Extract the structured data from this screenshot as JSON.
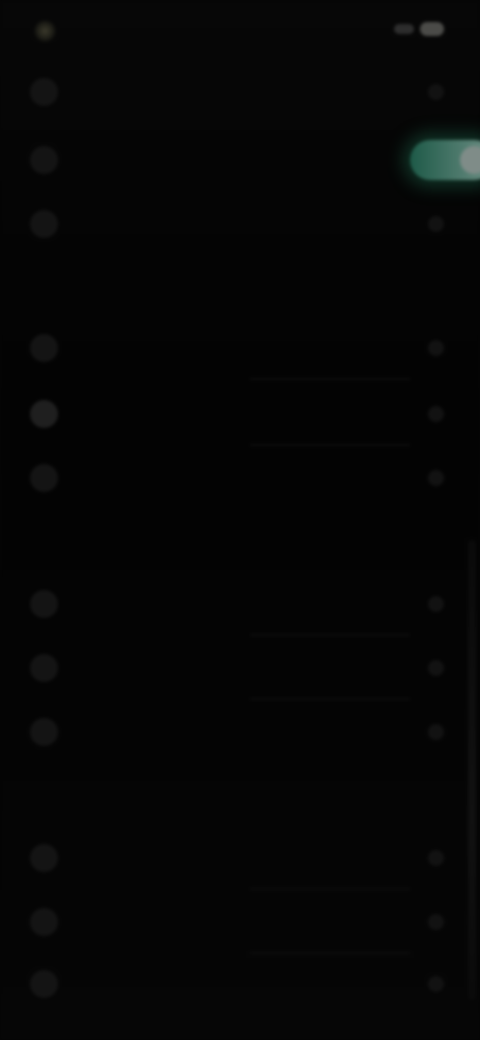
{
  "status_bar": {
    "left_text": "",
    "right_text": ""
  },
  "rows": [
    {
      "id": "row-1",
      "label": ""
    },
    {
      "id": "row-2",
      "label": ""
    },
    {
      "id": "row-3",
      "label": ""
    }
  ],
  "sections": [
    {
      "id": "section-1",
      "title": "",
      "rows": [
        {
          "label": ""
        },
        {
          "label": ""
        },
        {
          "label": ""
        }
      ]
    },
    {
      "id": "section-2",
      "title": "",
      "rows": [
        {
          "label": ""
        },
        {
          "label": ""
        },
        {
          "label": ""
        }
      ]
    },
    {
      "id": "section-3",
      "title": "",
      "rows": [
        {
          "label": ""
        },
        {
          "label": ""
        },
        {
          "label": ""
        }
      ]
    }
  ],
  "toggle": {
    "on": true
  },
  "colors": {
    "accent": "#2f8f6f",
    "background": "#050505"
  }
}
